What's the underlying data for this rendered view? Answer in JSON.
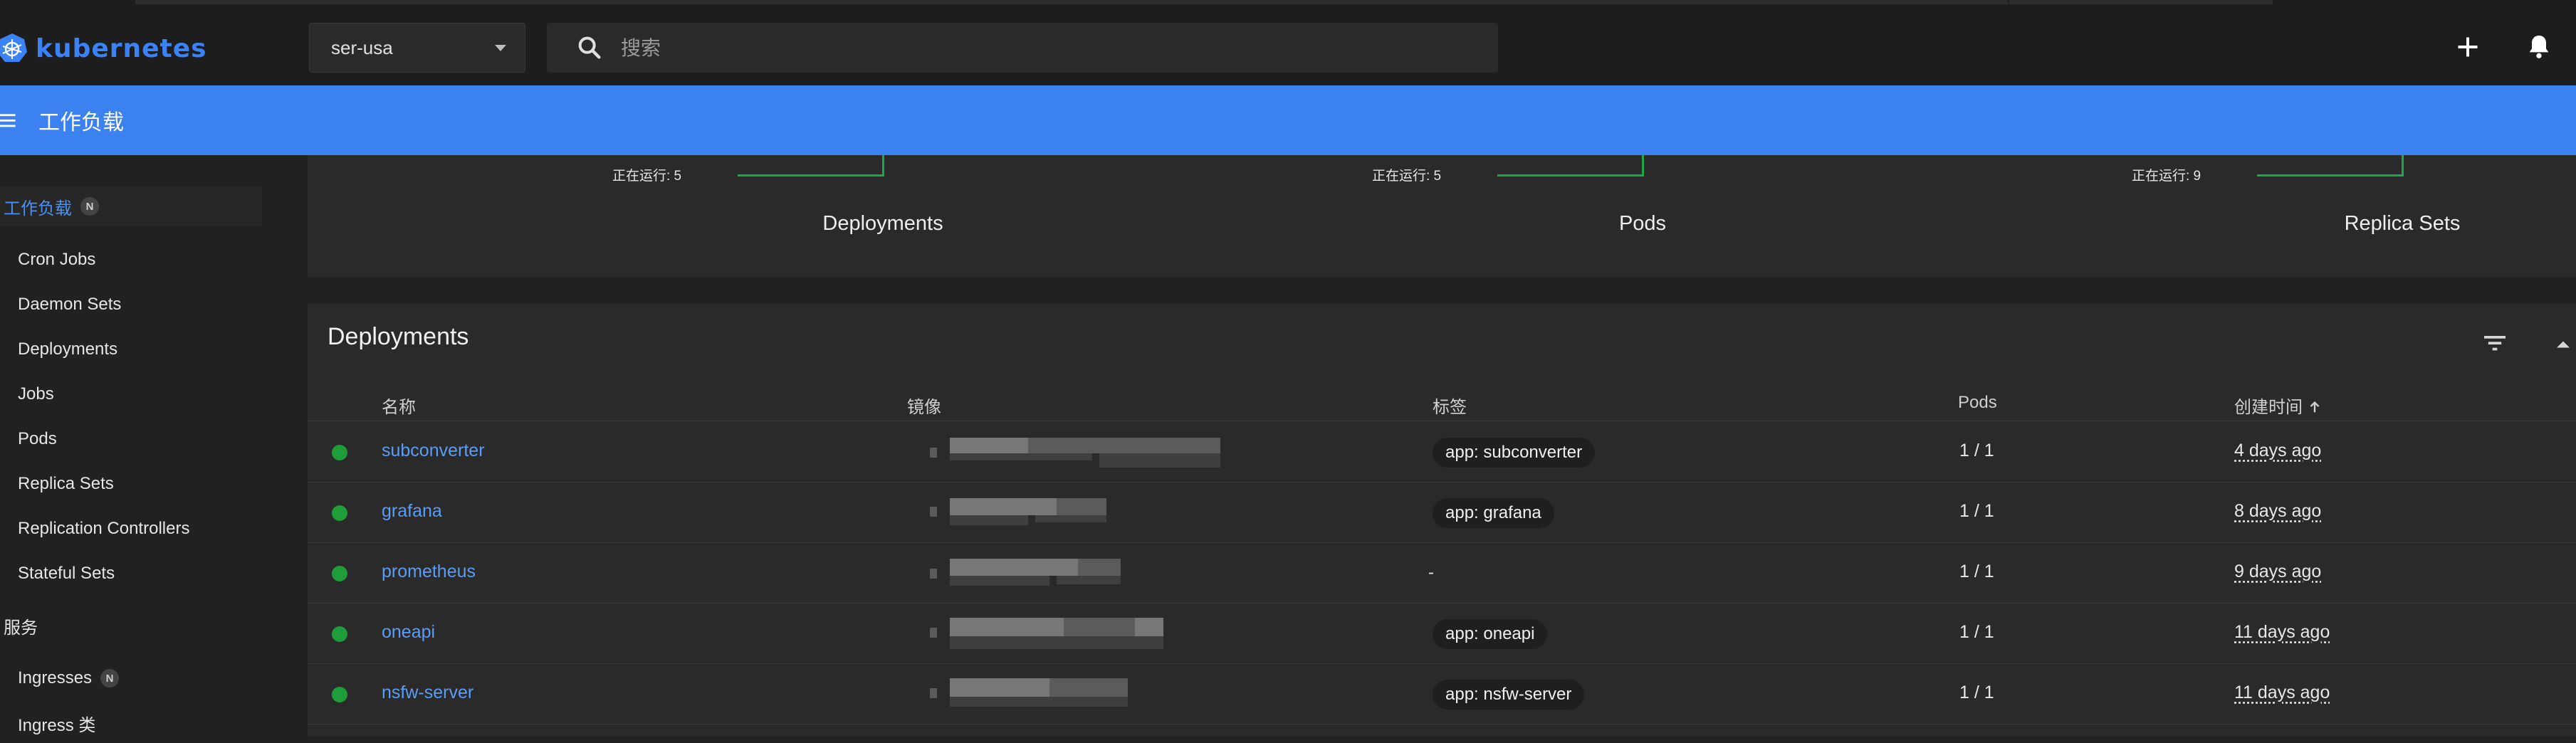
{
  "app": {
    "name": "kubernetes"
  },
  "header": {
    "namespace": "ser-usa",
    "search_placeholder": "搜索",
    "title": "工作负载"
  },
  "colors": {
    "accent": "#3b82f0",
    "link": "#5b9cf5",
    "status_ok": "#1f9d3a"
  },
  "icons": {
    "logo": "kubernetes-helm-icon",
    "search": "search-icon",
    "add": "plus-icon",
    "notifications": "bell-icon",
    "menu": "hamburger-icon",
    "filter": "filter-icon",
    "collapse": "chevron-up-icon",
    "sort": "arrow-up-icon"
  },
  "sidebar": {
    "workloads": {
      "label": "工作负载",
      "badge": "N"
    },
    "items": [
      {
        "label": "Cron Jobs"
      },
      {
        "label": "Daemon Sets"
      },
      {
        "label": "Deployments"
      },
      {
        "label": "Jobs"
      },
      {
        "label": "Pods"
      },
      {
        "label": "Replica Sets"
      },
      {
        "label": "Replication Controllers"
      },
      {
        "label": "Stateful Sets"
      }
    ],
    "services": {
      "label": "服务"
    },
    "service_items": [
      {
        "label": "Ingresses",
        "badge": "N"
      },
      {
        "label": "Ingress 类"
      }
    ]
  },
  "summary": [
    {
      "running": "正在运行: 5",
      "title": "Deployments"
    },
    {
      "running": "正在运行: 5",
      "title": "Pods"
    },
    {
      "running": "正在运行: 9",
      "title": "Replica Sets"
    }
  ],
  "deployments": {
    "title": "Deployments",
    "columns": {
      "name": "名称",
      "image": "镜像",
      "labels": "标签",
      "pods": "Pods",
      "created": "创建时间"
    },
    "rows": [
      {
        "name": "subconverter",
        "label": "app: subconverter",
        "pods": "1 / 1",
        "created": "4 days ago"
      },
      {
        "name": "grafana",
        "label": "app: grafana",
        "pods": "1 / 1",
        "created": "8 days ago"
      },
      {
        "name": "prometheus",
        "label": "-",
        "pods": "1 / 1",
        "created": "9 days ago"
      },
      {
        "name": "oneapi",
        "label": "app: oneapi",
        "pods": "1 / 1",
        "created": "11 days ago"
      },
      {
        "name": "nsfw-server",
        "label": "app: nsfw-server",
        "pods": "1 / 1",
        "created": "11 days ago"
      }
    ]
  }
}
